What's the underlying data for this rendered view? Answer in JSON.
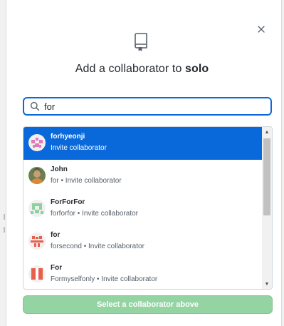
{
  "dialog": {
    "close_glyph": "×",
    "title_prefix": "Add a collaborator to ",
    "repo_name": "solo",
    "icon": "repo-icon"
  },
  "search": {
    "value": "for",
    "icon": "search-icon"
  },
  "results": [
    {
      "name": "forhyeonji",
      "subtitle": "Invite collaborator",
      "selected": true,
      "avatar": "pink-identicon"
    },
    {
      "name": "John",
      "subtitle": "for • Invite collaborator",
      "selected": false,
      "avatar": "photo-avatar"
    },
    {
      "name": "ForForFor",
      "subtitle": "forforfor • Invite collaborator",
      "selected": false,
      "avatar": "green-identicon"
    },
    {
      "name": "for",
      "subtitle": "forsecond • Invite collaborator",
      "selected": false,
      "avatar": "red-identicon"
    },
    {
      "name": "For",
      "subtitle": "Formyselfonly • Invite collaborator",
      "selected": false,
      "avatar": "red-white-identicon"
    }
  ],
  "scroll": {
    "up_glyph": "▲",
    "down_glyph": "▼"
  },
  "submit_label": "Select a collaborator above",
  "colors": {
    "selected_row": "#0969da",
    "submit_disabled": "#94d3a2",
    "focus_border": "#0969da"
  }
}
